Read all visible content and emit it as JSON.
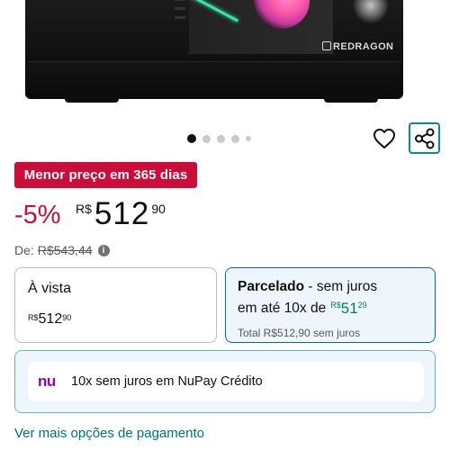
{
  "product_image": {
    "brand": "REDRAGON",
    "carousel": {
      "total": 5,
      "active_index": 0
    }
  },
  "actions": {
    "wishlist_icon": "heart-icon",
    "share_icon": "share-icon"
  },
  "deal": {
    "badge": "Menor preço em 365 dias",
    "badge_color": "#cc0c39"
  },
  "price": {
    "discount": "-5%",
    "currency": "R$",
    "whole": "512",
    "fraction": "90"
  },
  "list_price": {
    "label": "De:",
    "value": "R$543,44",
    "info_icon": "info-icon"
  },
  "payment": {
    "cash": {
      "title": "À vista",
      "currency": "R$",
      "whole": "512",
      "fraction": "90"
    },
    "installment": {
      "title": "Parcelado",
      "suffix": " - sem juros",
      "line2": "em até 10x de",
      "currency": "R$",
      "whole": "51",
      "fraction": "29",
      "total": "Total  R$512,90  sem juros",
      "accent": "#067d62"
    }
  },
  "nupay": {
    "logo": "nu",
    "text": "10x sem juros em NuPay Crédito"
  },
  "more_payment_link": "Ver mais opções de pagamento"
}
